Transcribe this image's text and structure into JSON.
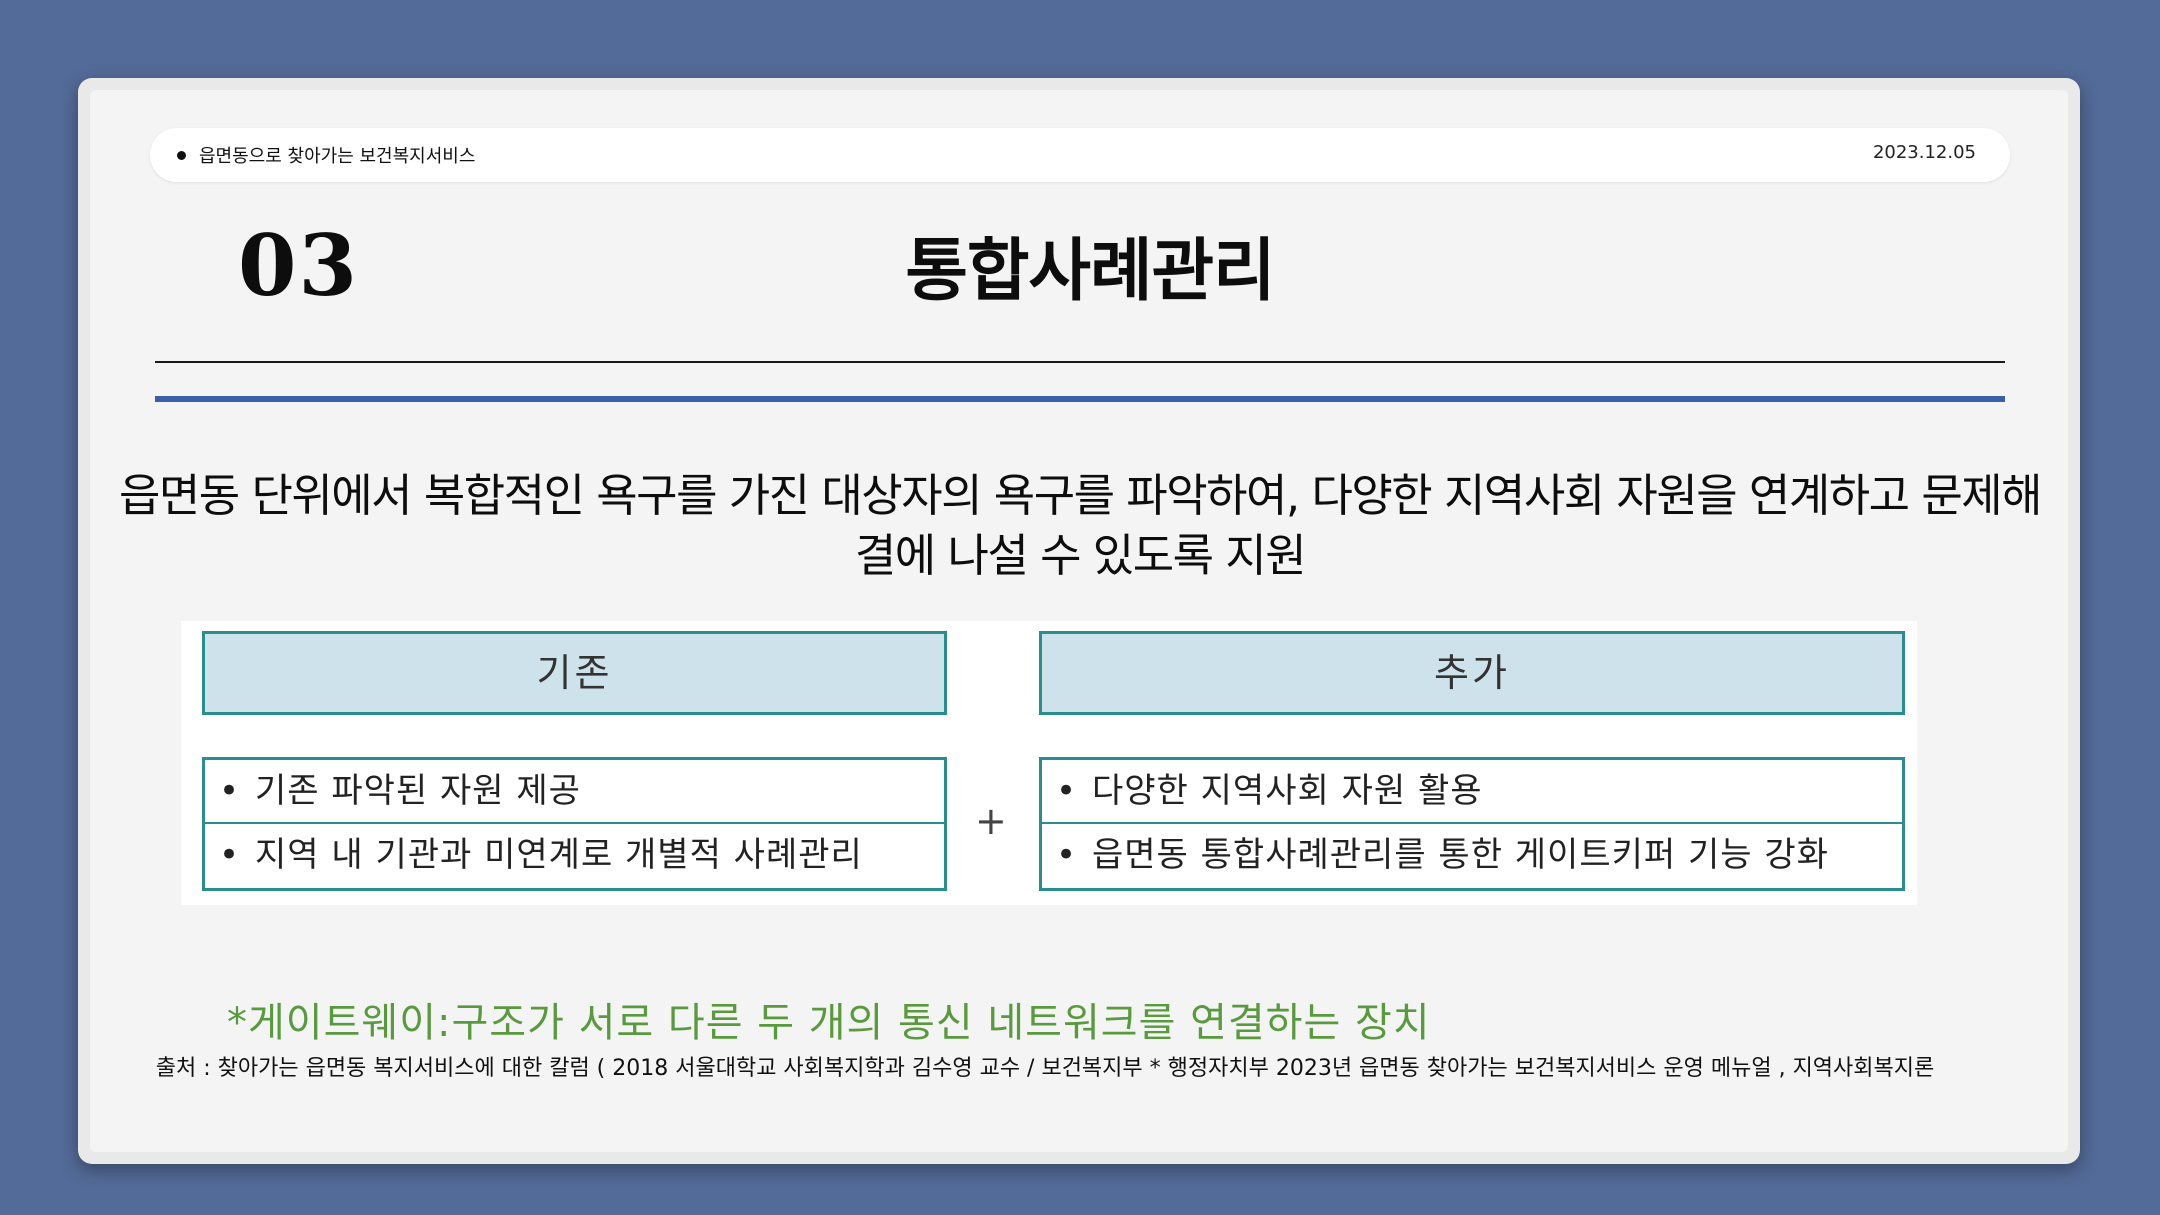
{
  "header": {
    "title": "읍면동으로 찾아가는 보건복지서비스",
    "date": "2023.12.05"
  },
  "section": {
    "number": "03",
    "title": "통합사례관리"
  },
  "description": "읍면동 단위에서 복합적인 욕구를 가진 대상자의 욕구를 파악하여, 다양한 지역사회 자원을 연계하고 문제해결에 나설 수 있도록 지원",
  "figure": {
    "left_header": "기존",
    "right_header": "추가",
    "plus": "+",
    "bullet": "•",
    "left_items": [
      "기존 파악된 자원 제공",
      "지역 내 기관과 미연계로 개별적 사례관리"
    ],
    "right_items": [
      "다양한 지역사회 자원 활용",
      "읍면동 통합사례관리를 통한 게이트키퍼 기능 강화"
    ]
  },
  "note": "*게이트웨이:구조가 서로 다른 두 개의 통신 네트워크를 연결하는 장치",
  "source": "출처 :  찾아가는 읍면동 복지서비스에 대한 칼럼 ( 2018 서울대학교 사회복지학과 김수영 교수 / 보건복지부 * 행정자치부 2023년 읍면동 찾아가는 보건복지서비스 운영 메뉴얼 , 지역사회복지론",
  "colors": {
    "background": "#536b98",
    "accent_blue": "#3b5ea8",
    "box_border": "#2a8f8c",
    "box_header_fill": "#cde2ea",
    "note_green": "#5a9a3e"
  }
}
